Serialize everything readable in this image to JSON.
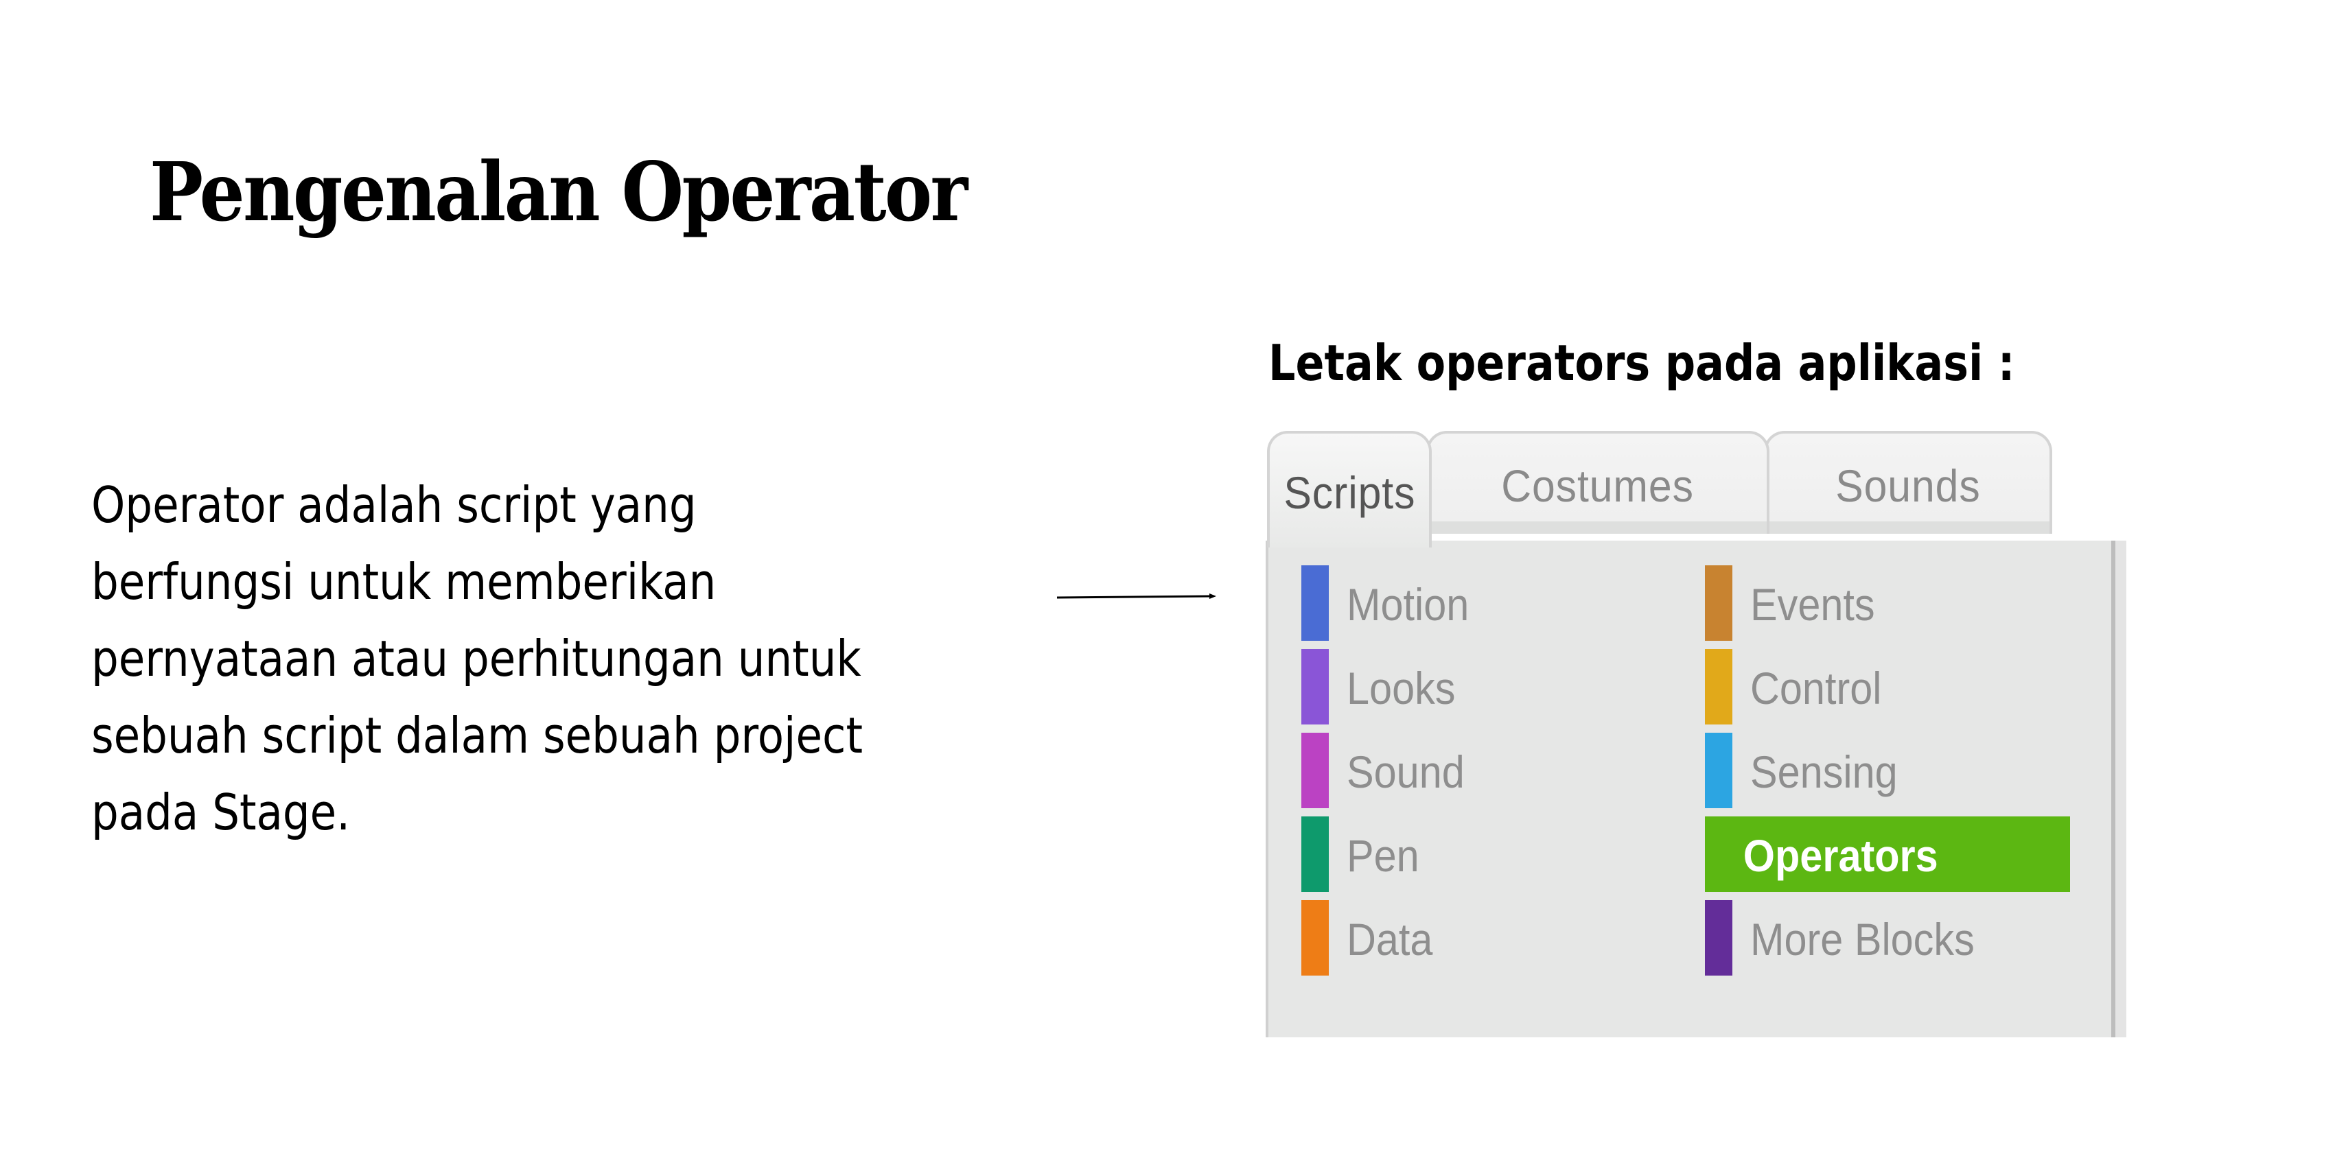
{
  "slide": {
    "title": "Pengenalan Operator",
    "body_lines": [
      "Operator adalah script yang",
      "berfungsi untuk memberikan",
      "pernyataan atau perhitungan untuk",
      "sebuah script dalam sebuah project",
      "pada Stage."
    ],
    "subheading": "Letak operators pada aplikasi :"
  },
  "scratch": {
    "tabs": [
      {
        "label": "Scripts",
        "active": true
      },
      {
        "label": "Costumes",
        "active": false
      },
      {
        "label": "Sounds",
        "active": false
      }
    ],
    "categories": [
      {
        "label": "Motion",
        "color": "#4a6cd4",
        "selected": false
      },
      {
        "label": "Looks",
        "color": "#8a55d7",
        "selected": false
      },
      {
        "label": "Sound",
        "color": "#bb42c3",
        "selected": false
      },
      {
        "label": "Pen",
        "color": "#0e9a6c",
        "selected": false
      },
      {
        "label": "Data",
        "color": "#ee7d16",
        "selected": false
      },
      {
        "label": "Events",
        "color": "#c88330",
        "selected": false
      },
      {
        "label": "Control",
        "color": "#e1a91a",
        "selected": false
      },
      {
        "label": "Sensing",
        "color": "#2ca5e2",
        "selected": false
      },
      {
        "label": "Operators",
        "color": "#5cb712",
        "selected": true
      },
      {
        "label": "More Blocks",
        "color": "#632d99",
        "selected": false
      }
    ]
  }
}
